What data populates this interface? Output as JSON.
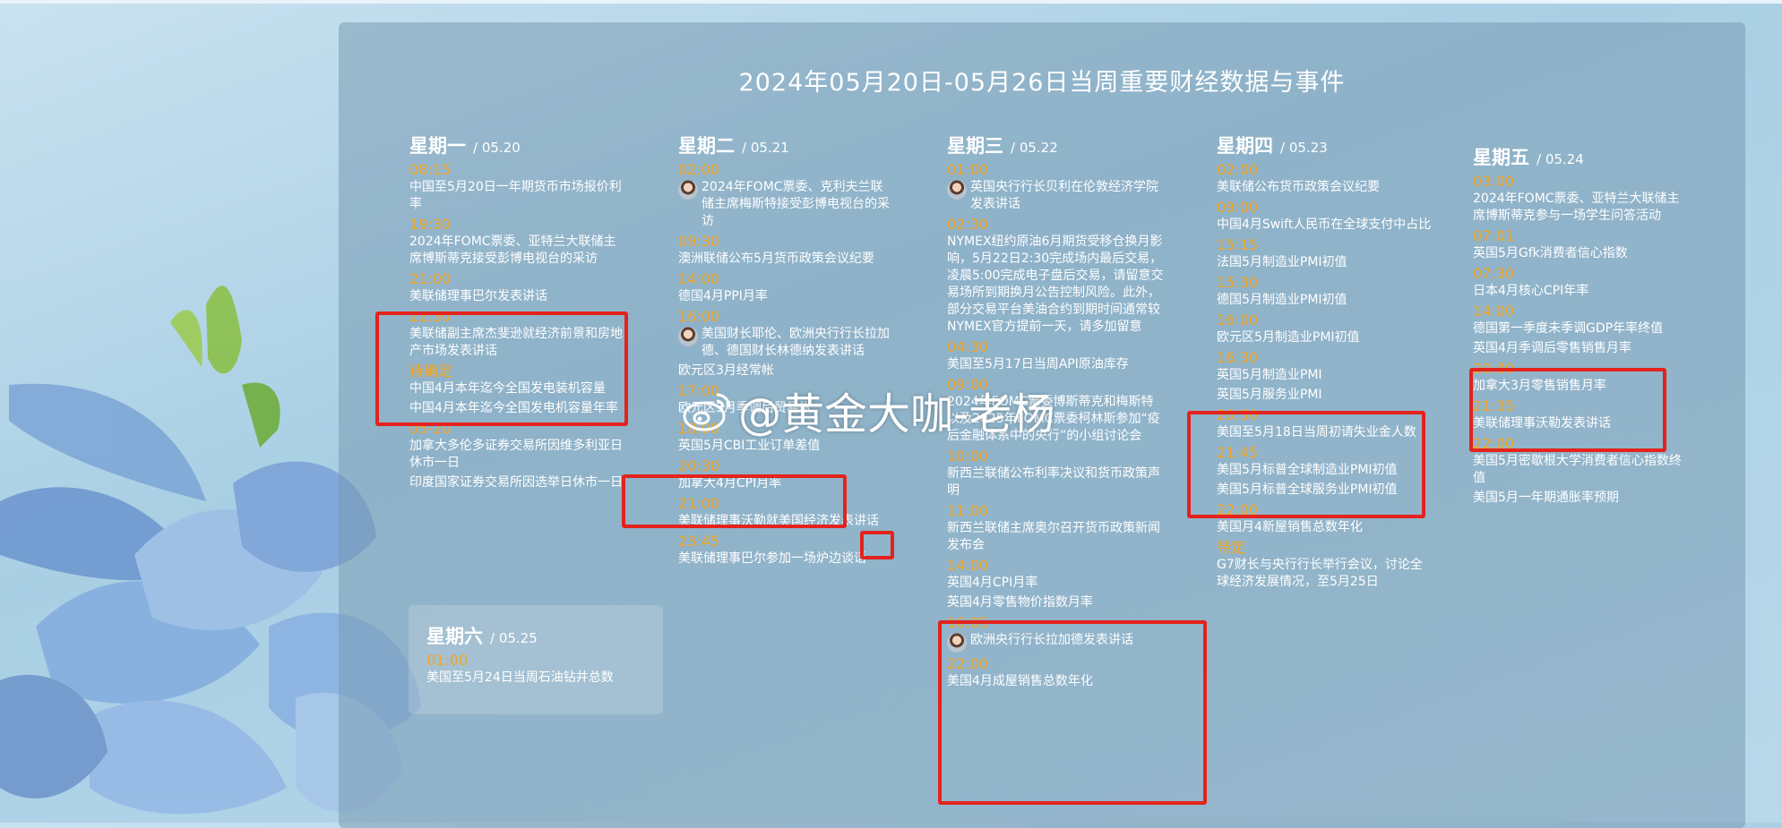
{
  "title": "2024年05月20日-05月26日当周重要财经数据与事件",
  "watermark": "@黄金大咖-老杨",
  "colors": {
    "time": "#f5a623",
    "highlight_box": "#e3231c",
    "text": "#ffffff"
  },
  "days": [
    {
      "name": "星期一",
      "date": "/ 05.20",
      "events": [
        {
          "time": "08:15",
          "text": "中国至5月20日一年期货币市场报价利率"
        },
        {
          "time": "19:30",
          "text": "2024年FOMC票委、亚特兰大联储主席博斯蒂克接受彭博电视台的采访"
        },
        {
          "time": "21:00",
          "text": "美联储理事巴尔发表讲话"
        },
        {
          "time": "22:30",
          "text": "美联储副主席杰斐逊就经济前景和房地产市场发表讲话"
        },
        {
          "time": "待确定",
          "text": "中国4月本年迄今全国发电装机容量"
        },
        {
          "time": "",
          "text": "中国4月本年迄今全国发电机容量年率"
        },
        {
          "time": "05-20",
          "text": "加拿大多伦多证券交易所因维多利亚日休市一日"
        },
        {
          "time": "",
          "text": "印度国家证券交易所因选举日休市一日"
        }
      ]
    },
    {
      "name": "星期二",
      "date": "/ 05.21",
      "events": [
        {
          "time": "02:00",
          "text": "2024年FOMC票委、克利夫兰联储主席梅斯特接受彭博电视台的采访",
          "avatar": true
        },
        {
          "time": "09:30",
          "text": "澳洲联储公布5月货币政策会议纪要"
        },
        {
          "time": "14:00",
          "text": "德国4月PPI月率"
        },
        {
          "time": "16:00",
          "text": "美国财长耶伦、欧洲央行行长拉加德、德国财长林德纳发表讲话",
          "avatar": true
        },
        {
          "time": "",
          "text": "欧元区3月经常帐"
        },
        {
          "time": "17:00",
          "text": "欧元区3月季调后贸易帐"
        },
        {
          "time": "18:00",
          "text": "英国5月CBI工业订单差值"
        },
        {
          "time": "20:30",
          "text": "加拿大4月CPI月率"
        },
        {
          "time": "21:00",
          "text": "美联储理事沃勒就美国经济发表讲话"
        },
        {
          "time": "23:45",
          "text": "美联储理事巴尔参加一场炉边谈话"
        }
      ]
    },
    {
      "name": "星期三",
      "date": "/ 05.22",
      "events": [
        {
          "time": "01:00",
          "text": "英国央行行长贝利在伦敦经济学院发表讲话",
          "avatar": true
        },
        {
          "time": "02:30",
          "text": "NYMEX纽约原油6月期货受移仓换月影响，5月22日2:30完成场内最后交易，凌晨5:00完成电子盘后交易，请留意交易场所到期换月公告控制风险。此外，部分交易平台美油合约到期时间通常较NYMEX官方提前一天，请多加留意"
        },
        {
          "time": "04:30",
          "text": "美国至5月17日当周API原油库存"
        },
        {
          "time": "09:00",
          "text": "2024年FOMC票委博斯蒂克和梅斯特以及2025年FOMC票委柯林斯参加“疫后金融体系中的央行”的小组讨论会"
        },
        {
          "time": "10:00",
          "text": "新西兰联储公布利率决议和货币政策声明"
        },
        {
          "time": "11:00",
          "text": "新西兰联储主席奥尔召开货币政策新闻发布会"
        },
        {
          "time": "14:00",
          "text": "英国4月CPI月率"
        },
        {
          "time": "",
          "text": "英国4月零售物价指数月率"
        },
        {
          "time": "16:05",
          "text": "欧洲央行行长拉加德发表讲话",
          "avatar": true
        },
        {
          "time": "22:00",
          "text": "美国4月成屋销售总数年化"
        }
      ]
    },
    {
      "name": "星期四",
      "date": "/ 05.23",
      "events": [
        {
          "time": "02:00",
          "text": "美联储公布货币政策会议纪要"
        },
        {
          "time": "09:00",
          "text": "中国4月Swift人民币在全球支付中占比"
        },
        {
          "time": "15:15",
          "text": "法国5月制造业PMI初值"
        },
        {
          "time": "15:30",
          "text": "德国5月制造业PMI初值"
        },
        {
          "time": "16:00",
          "text": "欧元区5月制造业PMI初值"
        },
        {
          "time": "16:30",
          "text": "英国5月制造业PMI"
        },
        {
          "time": "",
          "text": "英国5月服务业PMI"
        },
        {
          "time": "20:30",
          "text": "美国至5月18日当周初请失业金人数"
        },
        {
          "time": "21:45",
          "text": "美国5月标普全球制造业PMI初值"
        },
        {
          "time": "",
          "text": "美国5月标普全球服务业PMI初值"
        },
        {
          "time": "22:00",
          "text": "美国月4新屋销售总数年化"
        },
        {
          "time": "待定",
          "text": "G7财长与央行行长举行会议，讨论全球经济发展情况，至5月25日"
        }
      ]
    },
    {
      "name": "星期五",
      "date": "/ 05.24",
      "events": [
        {
          "time": "03:00",
          "text": "2024年FOMC票委、亚特兰大联储主席博斯蒂克参与一场学生问答活动"
        },
        {
          "time": "07:01",
          "text": "英国5月Gfk消费者信心指数"
        },
        {
          "time": "07:30",
          "text": "日本4月核心CPI年率"
        },
        {
          "time": "14:00",
          "text": "德国第一季度未季调GDP年率终值"
        },
        {
          "time": "",
          "text": "英国4月季调后零售销售月率"
        },
        {
          "time": "20:30",
          "text": "加拿大3月零售销售月率"
        },
        {
          "time": "21:35",
          "text": "美联储理事沃勒发表讲话"
        },
        {
          "time": "22:00",
          "text": "美国5月密歇根大学消费者信心指数终值"
        },
        {
          "time": "",
          "text": "美国5月一年期通胀率预期"
        }
      ]
    }
  ],
  "saturday": {
    "name": "星期六",
    "date": "/ 05.25",
    "events": [
      {
        "time": "01:00",
        "text": "美国至5月24日当周石油钻井总数"
      }
    ]
  }
}
